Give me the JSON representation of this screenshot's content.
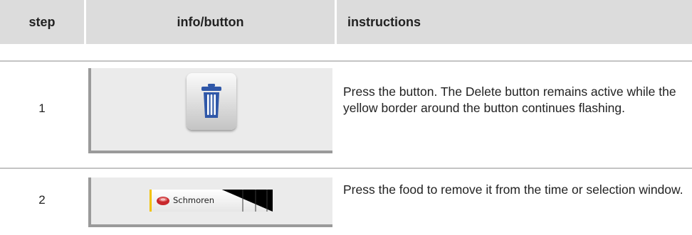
{
  "table": {
    "headers": {
      "step": "step",
      "info": "info/button",
      "instructions": "instructions"
    },
    "rows": [
      {
        "step": "1",
        "button_icon": "trash-can-icon",
        "instructions": "Press the button. The Delete button remains active while the yellow border around the button continues flashing."
      },
      {
        "step": "2",
        "button_icon": "pot-icon",
        "button_label": "Schmoren",
        "instructions": "Press the food to remove it from the time or selection window."
      }
    ]
  },
  "colors": {
    "header_bg": "#dcdcdc",
    "rule": "#c4c4c4",
    "trash_blue": "#2f57a8",
    "food_border_yellow": "#f2c200",
    "pot_red": "#c8282c"
  }
}
